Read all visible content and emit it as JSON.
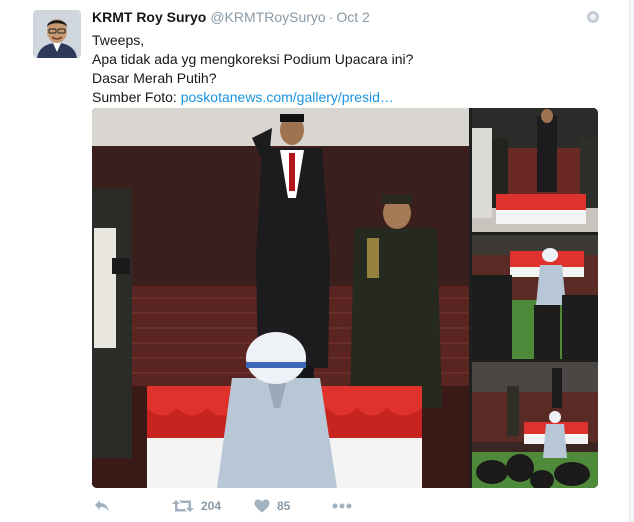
{
  "tweet": {
    "author_name": "KRMT Roy Suryo",
    "author_handle": "@KRMTRoySuryo",
    "separator": "·",
    "date": "Oct 2",
    "lines": [
      "Tweeps,",
      "Apa tidak ada yg mengkoreksi Podium Upacara ini?",
      "Dasar Merah Putih?"
    ],
    "source_label": "Sumber Foto:",
    "source_link": "poskotanews.com/gallery/presid…"
  },
  "actions": {
    "retweet_count": "204",
    "like_count": "85"
  },
  "colors": {
    "link": "#1b95e0",
    "podium_red": "#e0322c",
    "podium_white": "#f4f4f4"
  },
  "icons": {
    "reply": "reply-icon",
    "retweet": "retweet-icon",
    "like": "heart-icon",
    "more": "more-icon",
    "dropdown": "caret-icon"
  }
}
